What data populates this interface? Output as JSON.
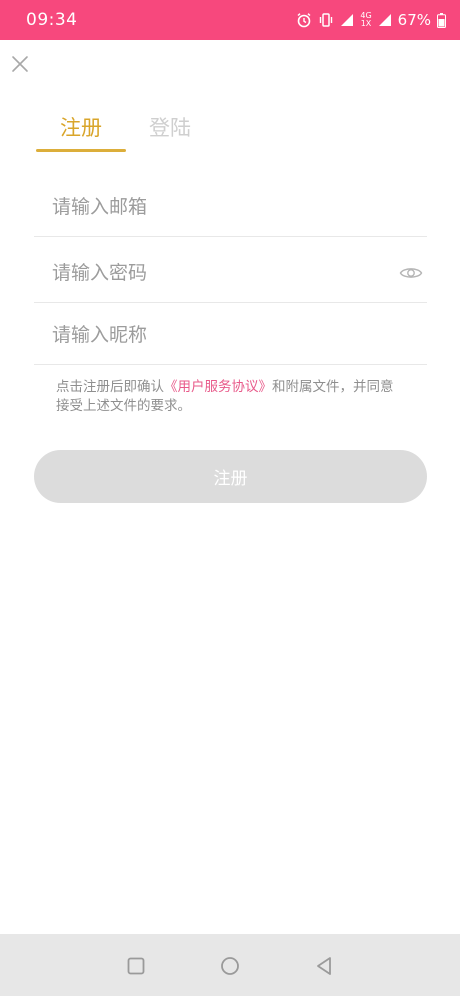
{
  "status_bar": {
    "time": "09:34",
    "battery_text": "67%",
    "network_top": "4G",
    "network_bottom": "1X",
    "icons": [
      "alarm-icon",
      "vibrate-icon",
      "signal-icon",
      "signal-4g-icon",
      "battery-icon"
    ]
  },
  "header": {
    "close_icon": "close-icon"
  },
  "tabs": [
    {
      "label": "注册",
      "active": true
    },
    {
      "label": "登陆",
      "active": false
    }
  ],
  "form": {
    "email_placeholder": "请输入邮箱",
    "password_placeholder": "请输入密码",
    "nickname_placeholder": "请输入昵称",
    "password_visibility_icon": "eye-icon"
  },
  "agreement": {
    "prefix": "点击注册后即确认",
    "link": "《用户服务协议》",
    "suffix": "和附属文件，并同意接受上述文件的要求。"
  },
  "submit_label": "注册",
  "nav_bar": {
    "icons": [
      "recents-icon",
      "home-icon",
      "back-icon"
    ]
  },
  "colors": {
    "status_bar": "#f7487d",
    "tab_active": "#d9a52a",
    "tab_inactive": "#cfcfcf",
    "link": "#e85a8a",
    "button_disabled": "#dcdcdc"
  }
}
